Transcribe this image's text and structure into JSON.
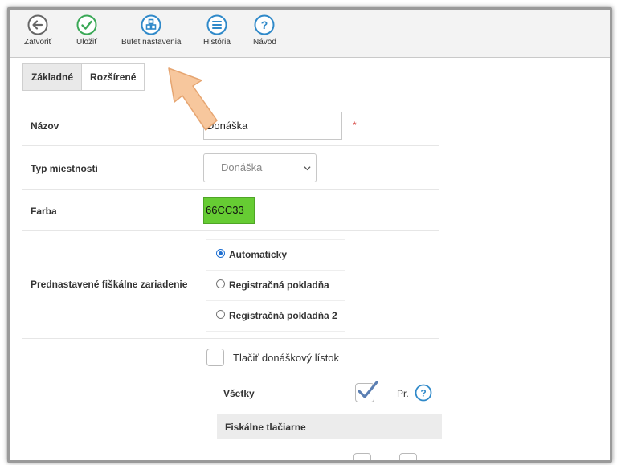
{
  "toolbar": {
    "close_label": "Zatvoriť",
    "save_label": "Uložiť",
    "buffet_label": "Bufet nastavenia",
    "history_label": "História",
    "help_label": "Návod"
  },
  "tabs": {
    "basic": "Základné",
    "advanced": "Rozšírené"
  },
  "form": {
    "name_label": "Názov",
    "name_value": "Donáška",
    "required_mark": "*",
    "room_type_label": "Typ miestnosti",
    "room_type_value": "Donáška",
    "color_label": "Farba",
    "color_value": "66CC33",
    "fiscal_label": "Prednastavené fiškálne zariadenie",
    "fiscal_options": [
      "Automaticky",
      "Registračná pokladňa",
      "Registračná pokladňa 2"
    ],
    "fiscal_selected": "Automaticky",
    "print_delivery_label": "Tlačiť donáškový lístok",
    "all_label": "Všetky",
    "pr_label": "Pr.",
    "fiscal_printers_label": "Fiskálne tlačiarne"
  },
  "colors": {
    "accent": "#1f6fd1",
    "color_swatch": "#66cc33",
    "save_green": "#3aa856",
    "icon_blue": "#2f89c9",
    "required": "#d9534f",
    "arrow": "#f7c79d"
  },
  "icons": [
    "back-arrow-icon",
    "check-circle-icon",
    "grid-icon",
    "menu-lines-icon",
    "question-icon",
    "chevron-down-icon",
    "checkmark-icon",
    "pointer-arrow-icon"
  ]
}
